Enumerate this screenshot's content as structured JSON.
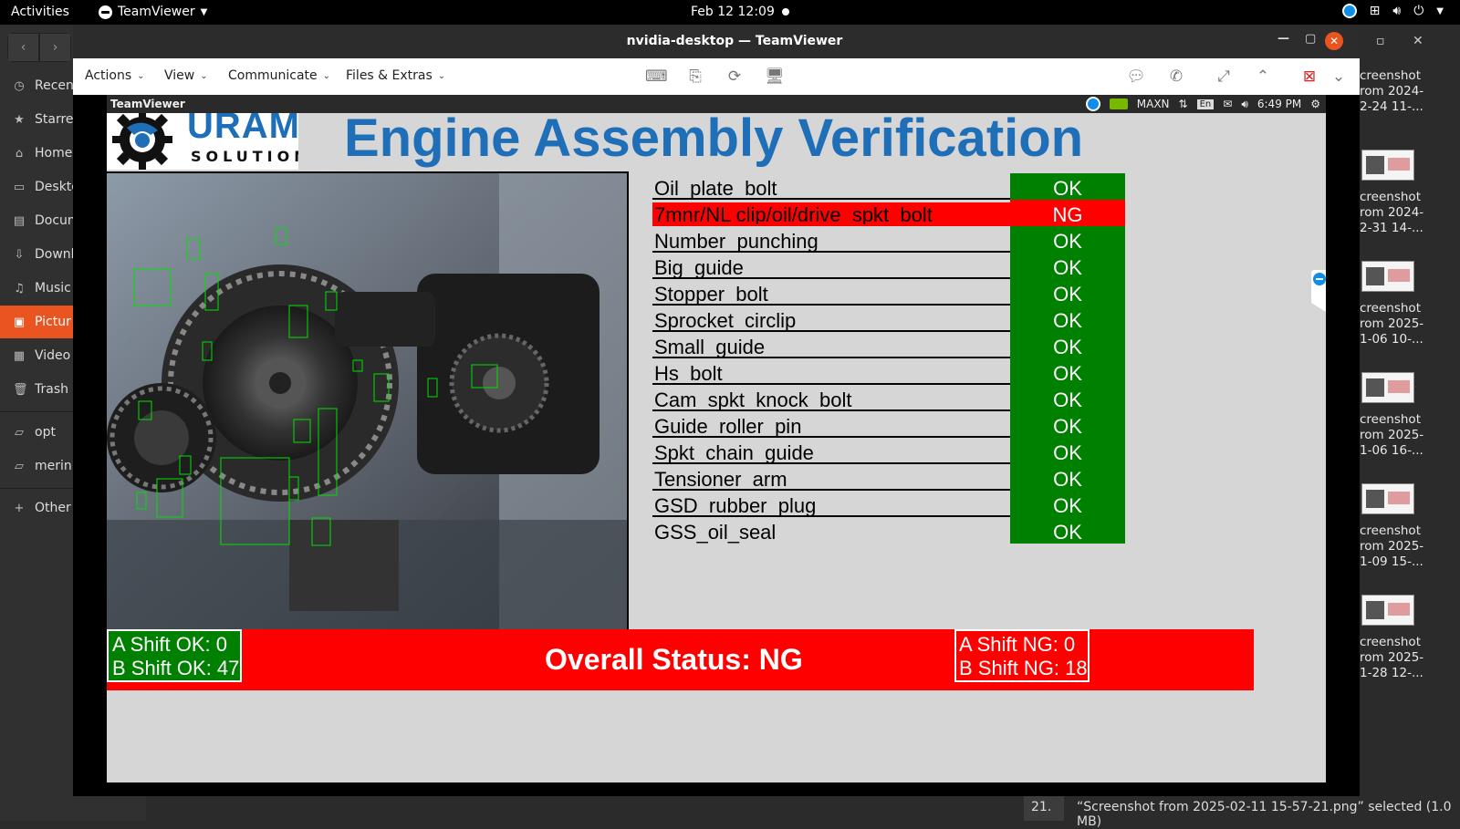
{
  "topbar": {
    "activities": "Activities",
    "app_name": "TeamViewer",
    "clock": "Feb 12  12:09"
  },
  "files_sidebar": {
    "items": [
      {
        "label": "Recen",
        "icon": "clock-icon"
      },
      {
        "label": "Starre",
        "icon": "star-icon"
      },
      {
        "label": "Home",
        "icon": "home-icon"
      },
      {
        "label": "Deskto",
        "icon": "desktop-icon"
      },
      {
        "label": "Docum",
        "icon": "document-icon"
      },
      {
        "label": "Downl",
        "icon": "download-icon"
      },
      {
        "label": "Music",
        "icon": "music-icon"
      },
      {
        "label": "Pictur",
        "icon": "picture-icon"
      },
      {
        "label": "Video",
        "icon": "video-icon"
      },
      {
        "label": "Trash",
        "icon": "trash-icon"
      },
      {
        "label": "opt",
        "icon": "folder-icon"
      },
      {
        "label": "merin",
        "icon": "folder-icon"
      },
      {
        "label": "Other",
        "icon": "plus-icon"
      }
    ]
  },
  "files_right": {
    "captions": [
      "creenshot\nrom 2024-\n2-24 11-...",
      "creenshot\nrom 2024-\n2-31 14-...",
      "creenshot\nrom 2025-\n1-06 10-...",
      "creenshot\nrom 2025-\n1-06 16-...",
      "creenshot\nrom 2025-\n1-09 15-...",
      "creenshot\nrom 2025-\n1-28 12-..."
    ]
  },
  "statusbar": {
    "num": "21.",
    "text": "“Screenshot from 2025-02-11 15-57-21.png” selected  (1.0 MB)"
  },
  "tv": {
    "window_title": "nvidia-desktop — TeamViewer",
    "menus": [
      "Actions",
      "View",
      "Communicate",
      "Files & Extras"
    ],
    "remote_bar_title": "TeamViewer",
    "remote_power_mode": "MAXN",
    "remote_lang": "En",
    "remote_time": "6:49 PM"
  },
  "app": {
    "logo_brand": "URAMA",
    "logo_sub": "SOLUTIONS",
    "title": "Engine Assembly Verification",
    "checks": [
      {
        "name": "Oil_plate_bolt",
        "status": "OK"
      },
      {
        "name": "7mnr/NL clip/oil/drive_spkt_bolt",
        "status": "NG"
      },
      {
        "name": "Number_punching",
        "status": "OK"
      },
      {
        "name": "Big_guide",
        "status": "OK"
      },
      {
        "name": "Stopper_bolt",
        "status": "OK"
      },
      {
        "name": "Sprocket_circlip",
        "status": "OK"
      },
      {
        "name": "Small_guide",
        "status": "OK"
      },
      {
        "name": "Hs_bolt",
        "status": "OK"
      },
      {
        "name": "Cam_spkt_knock_bolt",
        "status": "OK"
      },
      {
        "name": "Guide_roller_pin",
        "status": "OK"
      },
      {
        "name": "Spkt_chain_guide",
        "status": "OK"
      },
      {
        "name": "Tensioner_arm",
        "status": "OK"
      },
      {
        "name": "GSD_rubber_plug",
        "status": "OK"
      },
      {
        "name": "GSS_oil_seal",
        "status": "OK"
      }
    ],
    "a_shift_ok": "A Shift OK: 0",
    "b_shift_ok": "B Shift OK: 47",
    "overall_status": "Overall Status: NG",
    "a_shift_ng": "A Shift NG: 0",
    "b_shift_ng": "B Shift NG: 18"
  },
  "colors": {
    "ok": "#008000",
    "ng": "#ff0000",
    "title_blue": "#1e6fb8",
    "ubuntu_orange": "#e95420"
  }
}
